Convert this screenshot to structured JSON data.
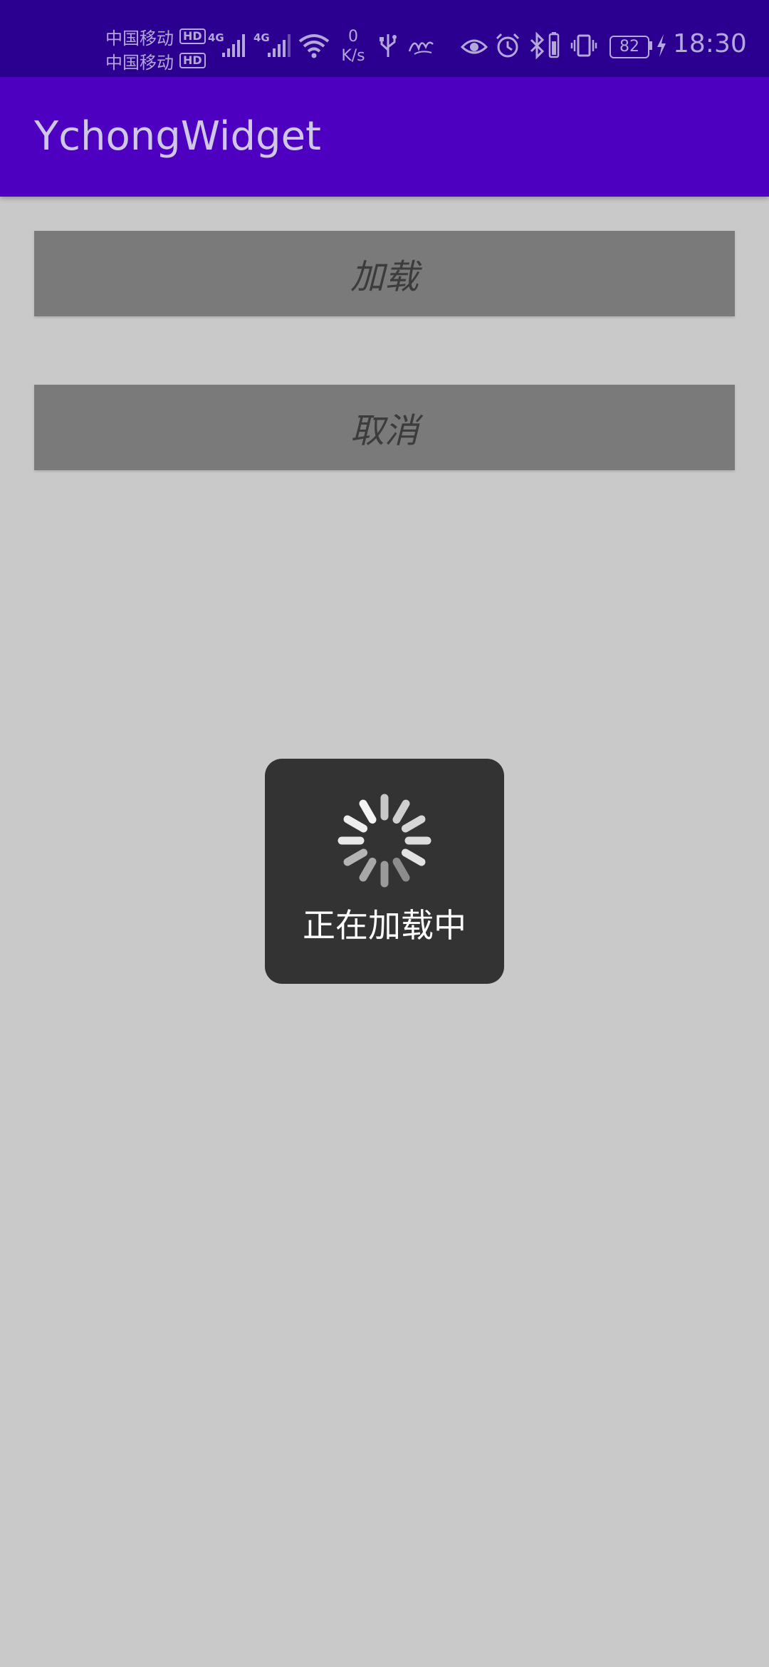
{
  "status_bar": {
    "carrier_1": "中国移动",
    "carrier_2": "中国移动",
    "hd_badge": "HD",
    "network_1": "4G",
    "network_2": "4G",
    "speed_value": "0",
    "speed_unit": "K/s",
    "battery_level": "82",
    "time": "18:30"
  },
  "app_bar": {
    "title": "YchongWidget"
  },
  "buttons": {
    "load_label": "加载",
    "cancel_label": "取消"
  },
  "loading_dialog": {
    "message": "正在加载中"
  },
  "colors": {
    "status_bar_bg": "#2b0090",
    "app_bar_bg": "#4d00c0",
    "page_bg": "#c9c9c9",
    "button_bg": "#7a7a7a",
    "dialog_bg": "#333333"
  },
  "icons": [
    "signal-icon",
    "wifi-icon",
    "usb-icon",
    "scribble-icon",
    "eye-icon",
    "alarm-icon",
    "bluetooth-icon",
    "vibrate-icon",
    "battery-icon",
    "charging-icon",
    "spinner-icon"
  ]
}
